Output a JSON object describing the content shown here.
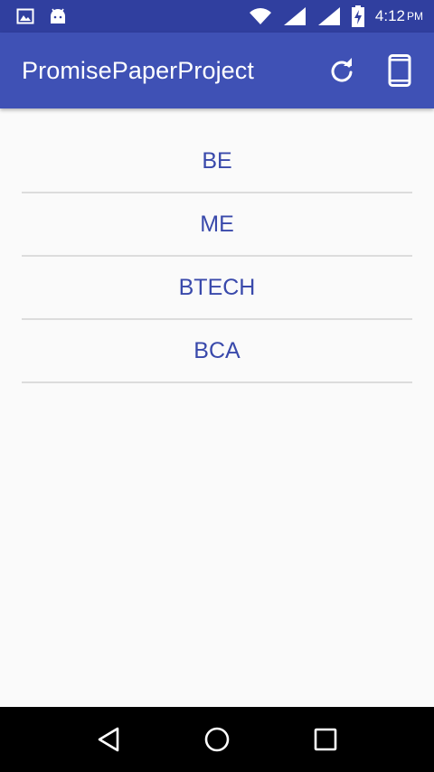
{
  "status_bar": {
    "time": "4:12",
    "ampm": "PM",
    "icons": [
      "image-icon",
      "android-icon",
      "wifi-icon",
      "signal-icon",
      "signal-icon",
      "battery-charging-icon"
    ]
  },
  "app_bar": {
    "title": "PromisePaperProject",
    "actions": [
      "refresh-icon",
      "phone-icon"
    ]
  },
  "course_list": {
    "items": [
      {
        "label": "BE"
      },
      {
        "label": "ME"
      },
      {
        "label": "BTECH"
      },
      {
        "label": "BCA"
      }
    ]
  },
  "nav_bar": {
    "buttons": [
      "back-icon",
      "home-icon",
      "recents-icon"
    ]
  },
  "colors": {
    "status_bar": "#303f9f",
    "app_bar": "#3f51b5",
    "list_text": "#3949ab",
    "divider": "#dcdcdc",
    "background": "#fafafa"
  }
}
